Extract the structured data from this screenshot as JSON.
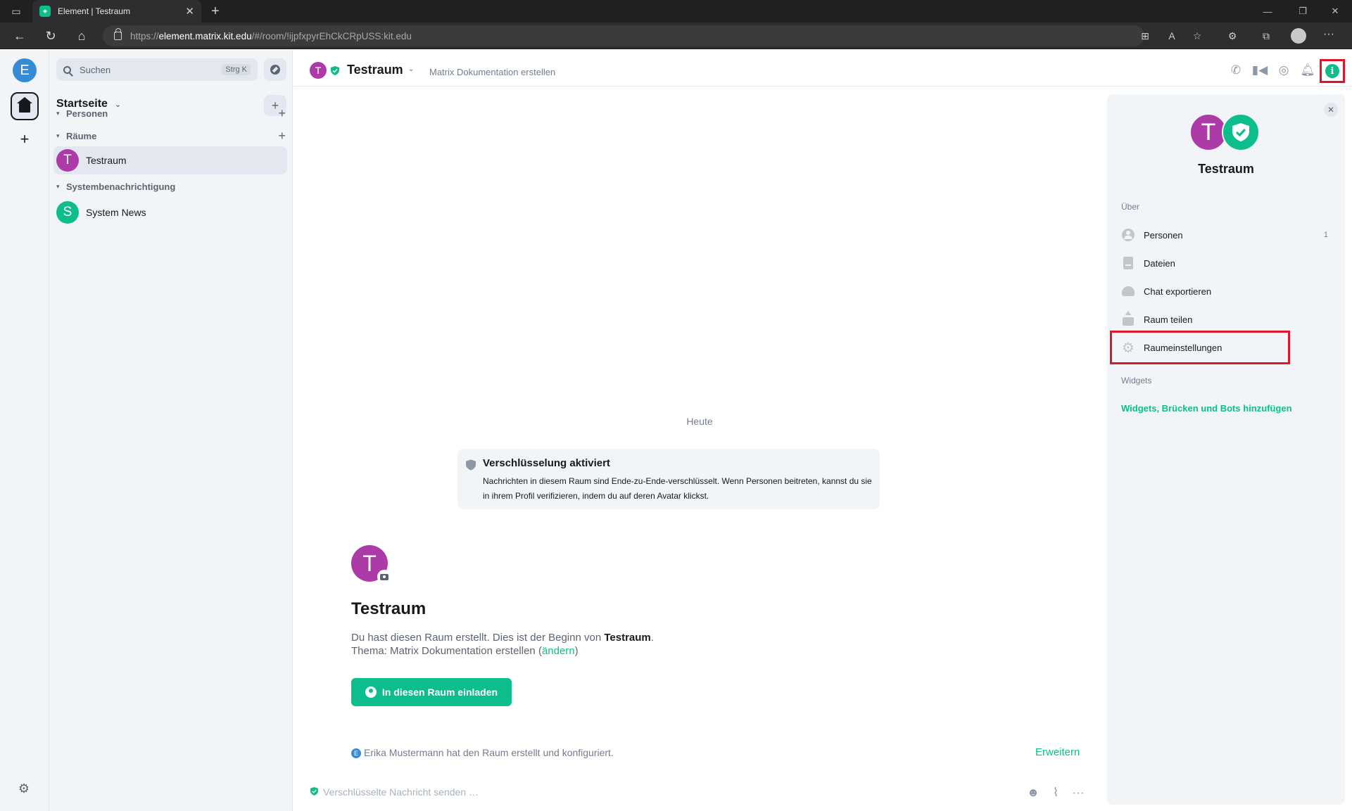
{
  "browser": {
    "tab_title": "Element | Testraum",
    "url_prefix": "https://",
    "url_host": "element.matrix.kit.edu",
    "url_path": "/#/room/!ijpfxpyrEhCkCRpUSS:kit.edu",
    "icons": [
      "tab-actions-icon",
      "element-favicon",
      "close-icon",
      "plus-icon",
      "minimize-icon",
      "restore-icon",
      "close-window-icon",
      "back-arrow-icon",
      "refresh-icon",
      "home-icon",
      "lock-icon",
      "apps-icon",
      "read-aloud-icon",
      "favorite-icon",
      "extensions-icon",
      "collections-icon",
      "profile-icon",
      "more-icon"
    ]
  },
  "spaces": {
    "user_initial": "E",
    "icons": [
      "home-icon",
      "plus-icon",
      "gear-icon"
    ]
  },
  "room_list": {
    "search_placeholder": "Suchen",
    "search_shortcut": "Strg K",
    "home_title": "Startseite",
    "sections": {
      "people": "Personen",
      "rooms": "Räume",
      "system": "Systembenachrichtigung"
    },
    "rooms": [
      {
        "initial": "T",
        "name": "Testraum",
        "color": "#ac3ba8"
      }
    ],
    "system_rooms": [
      {
        "initial": "S",
        "name": "System News",
        "color": "#0dbd8b"
      }
    ]
  },
  "room_header": {
    "initial": "T",
    "name": "Testraum",
    "topic": "Matrix Dokumentation erstellen",
    "icons": [
      "phone-icon",
      "video-icon",
      "search-icon",
      "bell-icon",
      "info-icon"
    ],
    "info_glyph": "i"
  },
  "timeline": {
    "date_separator": "Heute",
    "encryption": {
      "title": "Verschlüsselung aktiviert",
      "description": "Nachrichten in diesem Raum sind Ende-zu-Ende-verschlüsselt. Wenn Personen beitreten, kannst du sie in ihrem Profil verifizieren, indem du auf deren Avatar klickst."
    },
    "new_room": {
      "initial": "T",
      "title": "Testraum",
      "created_prefix": "Du hast diesen Raum erstellt. Dies ist der Beginn von ",
      "created_room": "Testraum",
      "created_suffix": ".",
      "topic_prefix": "Thema: Matrix Dokumentation erstellen (",
      "topic_change": "ändern",
      "topic_suffix": ")",
      "invite_label": "In diesen Raum einladen"
    },
    "summary": {
      "initial": "E",
      "text": "Erika Mustermann hat den Raum erstellt und konfiguriert.",
      "expand": "Erweitern"
    }
  },
  "composer": {
    "placeholder": "Verschlüsselte Nachricht senden …",
    "icons": [
      "emoji-icon",
      "attachment-icon",
      "more-options-icon"
    ]
  },
  "right_panel": {
    "initial": "T",
    "name": "Testraum",
    "about_label": "Über",
    "items": [
      {
        "label": "Personen",
        "count": "1",
        "icon": "people-icon"
      },
      {
        "label": "Dateien",
        "icon": "files-icon"
      },
      {
        "label": "Chat exportieren",
        "icon": "export-icon"
      },
      {
        "label": "Raum teilen",
        "icon": "share-icon"
      },
      {
        "label": "Raumeinstellungen",
        "icon": "settings-icon"
      }
    ],
    "widgets_label": "Widgets",
    "widgets_link": "Widgets, Brücken und Bots hinzufügen"
  },
  "colors": {
    "accent": "#0dbd8b",
    "room_avatar": "#ac3ba8",
    "user_avatar": "#368bd6",
    "highlight": "#e0142d"
  }
}
